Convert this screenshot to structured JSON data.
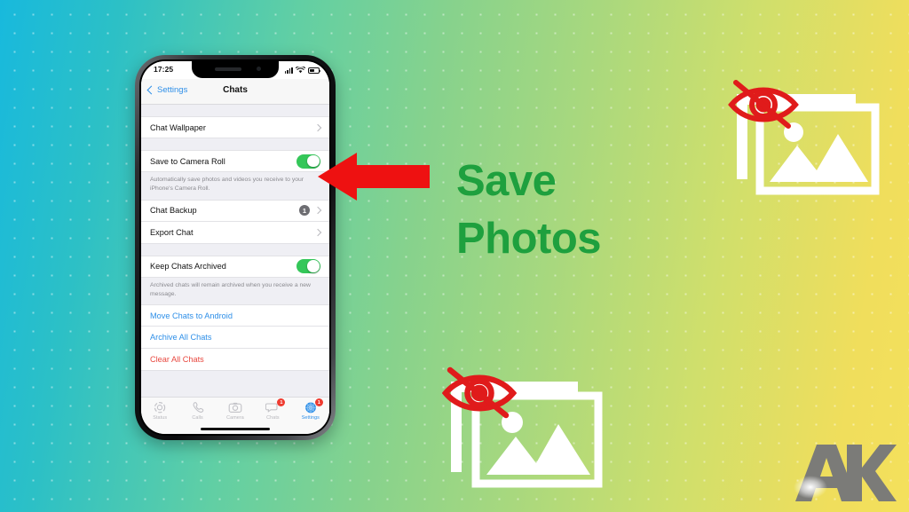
{
  "background": {
    "gradient_from": "#18b9dd",
    "gradient_mid": "#86d28d",
    "gradient_to": "#f4e05c",
    "pattern": "dot-grid"
  },
  "headline": {
    "line1": "Save",
    "line2": "Photos",
    "color": "#1ea03e"
  },
  "arrow": {
    "name": "red-left-arrow",
    "color": "#ee1111",
    "direction": "left"
  },
  "logo": {
    "text": "AK",
    "color": "#7b7b78"
  },
  "photo_icons": [
    {
      "name": "hidden-photos-icon-top",
      "image_color": "#ffffff",
      "eye_color": "#e01b1b"
    },
    {
      "name": "hidden-photos-icon-bottom",
      "image_color": "#ffffff",
      "eye_color": "#e01b1b"
    }
  ],
  "phone": {
    "status_bar": {
      "time": "17:25",
      "signal_icon": "cellular-signal-icon",
      "wifi_icon": "wifi-icon",
      "battery_icon": "battery-icon"
    },
    "nav": {
      "back_label": "Settings",
      "title": "Chats"
    },
    "sections": [
      {
        "rows": [
          {
            "label": "Chat Wallpaper",
            "accessory": "chevron"
          }
        ]
      },
      {
        "rows": [
          {
            "label": "Save to Camera Roll",
            "accessory": "toggle",
            "toggle_on": true
          }
        ],
        "footer": "Automatically save photos and videos you receive to your iPhone's Camera Roll."
      },
      {
        "rows": [
          {
            "label": "Chat Backup",
            "accessory": "badge-chevron",
            "badge": "1"
          },
          {
            "label": "Export Chat",
            "accessory": "chevron"
          }
        ]
      },
      {
        "rows": [
          {
            "label": "Keep Chats Archived",
            "accessory": "toggle",
            "toggle_on": true
          }
        ],
        "footer": "Archived chats will remain archived when you receive a new message."
      },
      {
        "rows": [
          {
            "label": "Move Chats to Android",
            "style": "link"
          },
          {
            "label": "Archive All Chats",
            "style": "link"
          },
          {
            "label": "Clear All Chats",
            "style": "danger"
          }
        ]
      }
    ],
    "tabs": [
      {
        "label": "Status",
        "icon": "status-ring-icon",
        "active": false,
        "badge": ""
      },
      {
        "label": "Calls",
        "icon": "phone-icon",
        "active": false,
        "badge": ""
      },
      {
        "label": "Camera",
        "icon": "camera-icon",
        "active": false,
        "badge": ""
      },
      {
        "label": "Chats",
        "icon": "chat-bubble-icon",
        "active": false,
        "badge": "1"
      },
      {
        "label": "Settings",
        "icon": "gear-icon",
        "active": true,
        "badge": "1"
      }
    ]
  }
}
